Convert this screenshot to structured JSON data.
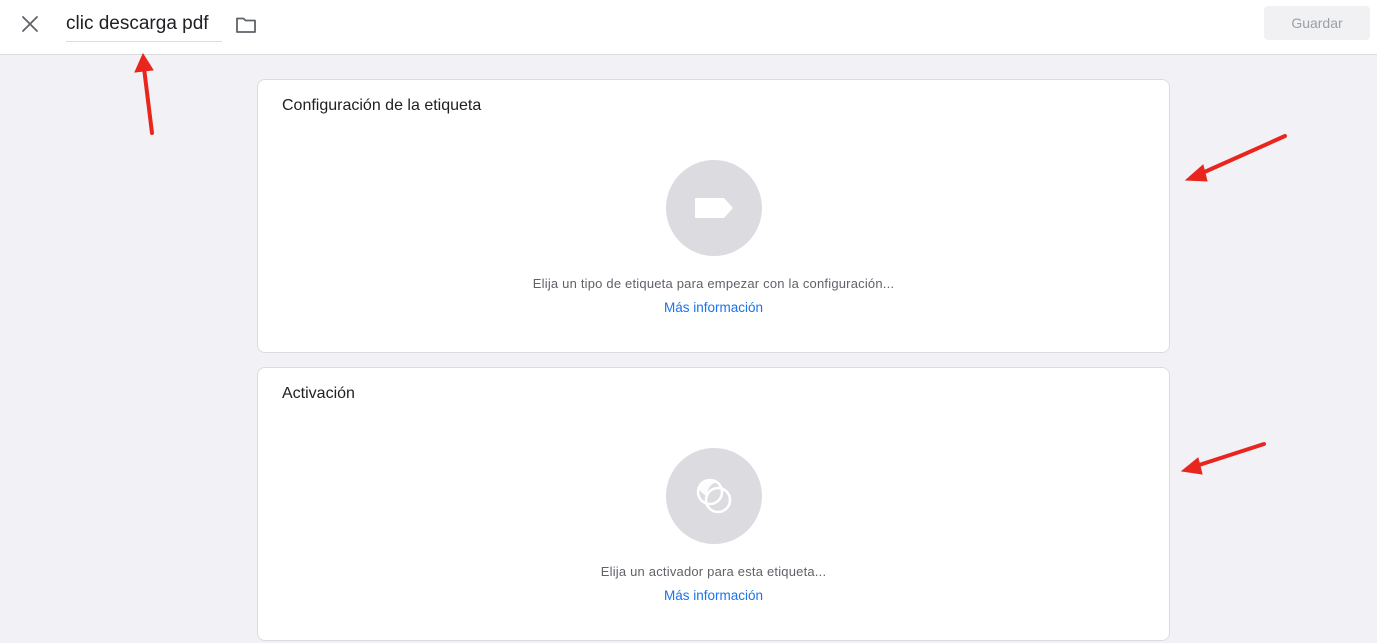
{
  "header": {
    "close_icon": "close-icon",
    "title_value": "clic descarga pdf",
    "folder_icon": "folder-icon",
    "save_label": "Guardar"
  },
  "tag_config": {
    "title": "Configuración de la etiqueta",
    "icon": "tag-icon",
    "description": "Elija un tipo de etiqueta para empezar con la configuración...",
    "link": "Más información"
  },
  "triggering": {
    "title": "Activación",
    "icon": "trigger-icon",
    "description": "Elija un activador para esta etiqueta...",
    "link": "Más información"
  },
  "colors": {
    "accent_link": "#1a73e8",
    "annotation_arrow": "#e8261e",
    "circle_bg": "#dcdce0",
    "page_bg": "#f1f1f6"
  }
}
